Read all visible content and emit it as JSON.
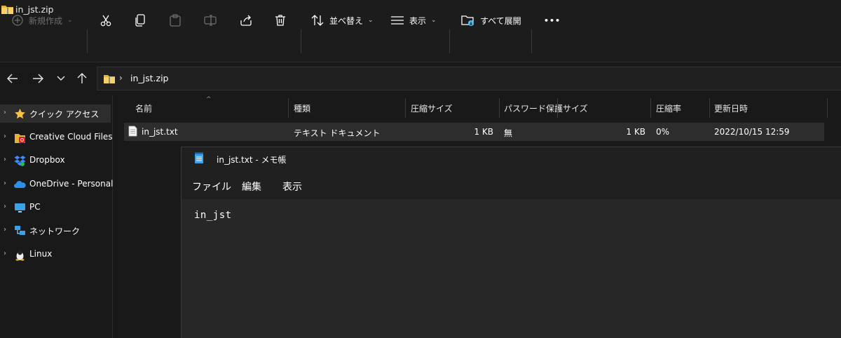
{
  "window": {
    "title": "in_jst.zip"
  },
  "toolbar": {
    "new_label": "新規作成",
    "sort_label": "並べ替え",
    "view_label": "表示",
    "extract_label": "すべて展開",
    "more_label": "•••"
  },
  "address": {
    "path": "in_jst.zip"
  },
  "sidebar": {
    "items": [
      {
        "label": "クイック アクセス",
        "icon": "star-icon"
      },
      {
        "label": "Creative Cloud Files",
        "icon": "creative-cloud-icon"
      },
      {
        "label": "Dropbox",
        "icon": "dropbox-icon"
      },
      {
        "label": "OneDrive - Personal",
        "icon": "onedrive-icon"
      },
      {
        "label": "PC",
        "icon": "pc-icon"
      },
      {
        "label": "ネットワーク",
        "icon": "network-icon"
      },
      {
        "label": "Linux",
        "icon": "linux-icon"
      }
    ]
  },
  "columns": {
    "name": "名前",
    "type": "種類",
    "compressed_size": "圧縮サイズ",
    "password": "パスワード保護",
    "size": "サイズ",
    "ratio": "圧縮率",
    "modified": "更新日時"
  },
  "files": [
    {
      "name": "in_jst.txt",
      "type": "テキスト ドキュメント",
      "compressed_size": "1 KB",
      "password": "無",
      "size": "1 KB",
      "ratio": "0%",
      "modified": "2022/10/15 12:59"
    }
  ],
  "notepad": {
    "title": "in_jst.txt - メモ帳",
    "menu": {
      "file": "ファイル",
      "edit": "編集",
      "view": "表示"
    },
    "content": "in_jst"
  },
  "colors": {
    "background": "#191919",
    "selection": "#2d2d2d",
    "notepad_bg": "#272727",
    "folder": "#f2c94c",
    "accent": "#4cc2ff"
  }
}
